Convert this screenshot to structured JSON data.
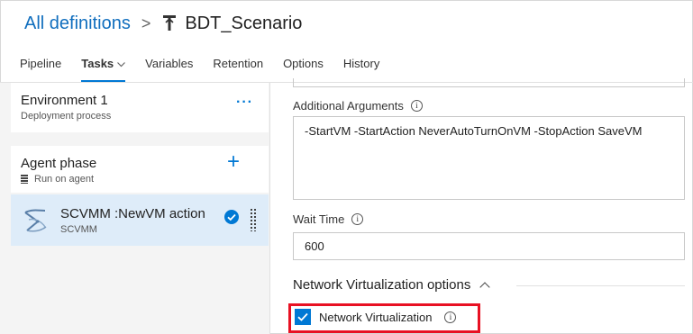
{
  "header": {
    "breadcrumb_root": "All definitions",
    "separator": ">",
    "title": "BDT_Scenario",
    "icon": "pipeline-icon"
  },
  "tabs": [
    {
      "label": "Pipeline",
      "active": false
    },
    {
      "label": "Tasks",
      "active": true
    },
    {
      "label": "Variables",
      "active": false
    },
    {
      "label": "Retention",
      "active": false
    },
    {
      "label": "Options",
      "active": false
    },
    {
      "label": "History",
      "active": false
    }
  ],
  "environment": {
    "title": "Environment 1",
    "subtitle": "Deployment process",
    "more": "···"
  },
  "agent_phase": {
    "title": "Agent phase",
    "subtitle": "Run on agent",
    "add": "+"
  },
  "task": {
    "title": "SCVMM :NewVM action",
    "subtitle": "SCVMM"
  },
  "form": {
    "additional_arguments_label": "Additional Arguments",
    "additional_arguments_value": "-StartVM -StartAction NeverAutoTurnOnVM -StopAction SaveVM",
    "wait_time_label": "Wait Time",
    "wait_time_value": "600",
    "section_title": "Network Virtualization options",
    "network_virtualization_label": "Network Virtualization",
    "network_virtualization_checked": true,
    "info_glyph": "i"
  },
  "colors": {
    "accent": "#0078d4",
    "link": "#106ebe",
    "selected_bg": "#deecf9",
    "highlight": "#e81123"
  }
}
